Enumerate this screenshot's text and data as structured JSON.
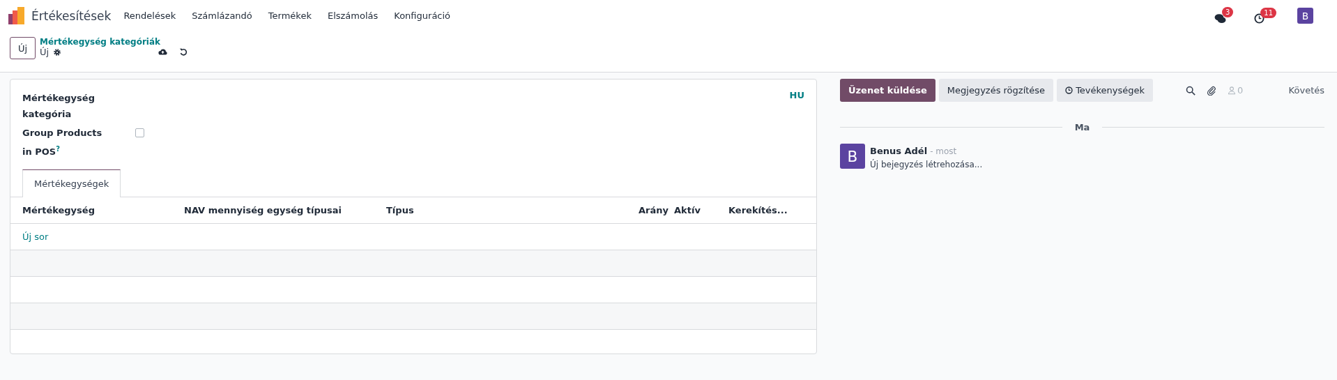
{
  "navbar": {
    "app_name": "Értékesítések",
    "menu": [
      "Rendelések",
      "Számlázandó",
      "Termékek",
      "Elszámolás",
      "Konfiguráció"
    ],
    "systray": [
      {
        "kind": "chat",
        "badge": "3"
      },
      {
        "kind": "activity",
        "badge": "11"
      }
    ],
    "avatar": "B"
  },
  "control_panel": {
    "new_button": "Új",
    "breadcrumb": "Mértékegység kategóriák",
    "record_name": "Új"
  },
  "form": {
    "lang": "HU",
    "fields": [
      {
        "kind": "text",
        "label": "Mértékegység kategória"
      },
      {
        "kind": "checkbox",
        "label": "Group Products in POS",
        "help": "?",
        "checked": false
      }
    ],
    "tabs": [
      {
        "label": "Mértékegységek",
        "selected": true
      }
    ],
    "table": {
      "columns": [
        {
          "label": "Mértékegység",
          "kind": "text"
        },
        {
          "label": "NAV mennyiség egység típusai",
          "kind": "text"
        },
        {
          "label": "Típus",
          "kind": "text"
        },
        {
          "label": "Arány",
          "kind": "number"
        },
        {
          "label": "Aktív",
          "kind": "text"
        },
        {
          "label": "Kerekítés...",
          "kind": "text"
        }
      ],
      "add_line": "Új sor"
    }
  },
  "chatter": {
    "buttons": [
      {
        "label": "Üzenet küldése",
        "selected": true,
        "icon": false
      },
      {
        "label": "Megjegyzés rögzítése",
        "selected": false,
        "icon": false
      },
      {
        "label": "Tevékenységek",
        "selected": false,
        "icon": true
      }
    ],
    "followers": "0",
    "follow": "Követés",
    "date_separator": "Ma",
    "messages": [
      {
        "avatar": "B",
        "author": "Benus Adél",
        "time": "- most",
        "body": "Új bejegyzés létrehozása..."
      }
    ]
  }
}
